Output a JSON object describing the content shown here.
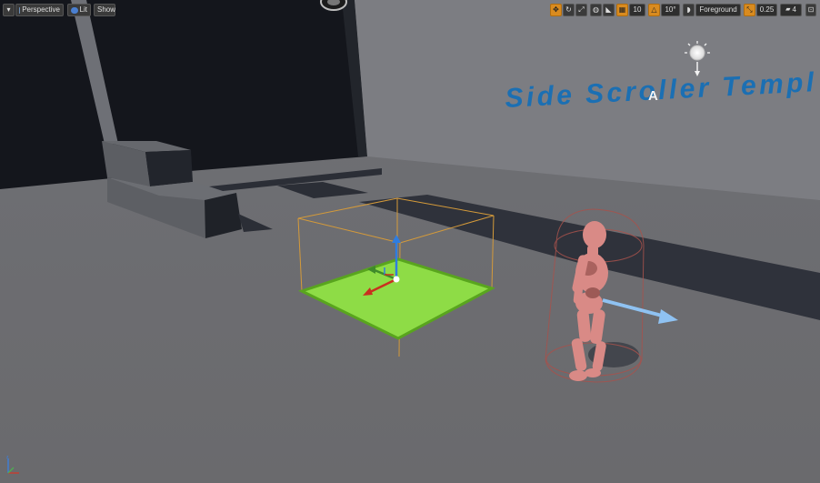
{
  "toolbar_left": {
    "menu_icon": "chevron-down-icon",
    "perspective_label": "Perspective",
    "lit_label": "Lit",
    "show_label": "Show"
  },
  "toolbar_right": {
    "grid_snap_value": "10",
    "rotation_snap_value": "10°",
    "layer_label": "Foreground",
    "scale_snap_value": "0.25",
    "camera_speed_value": "4"
  },
  "scene": {
    "wall_text": "Side Scroller Templ",
    "actor_label": "A"
  },
  "colors": {
    "wall_text": "#1b6fb3",
    "platform_green": "#8edc46",
    "accent_orange": "#d98b1f",
    "mannequin": "#d98a86"
  }
}
